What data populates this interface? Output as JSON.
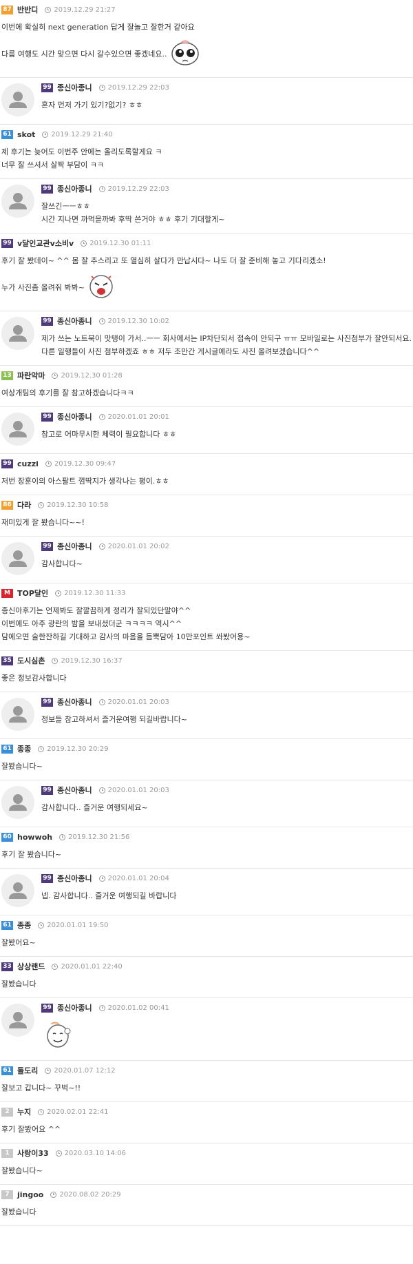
{
  "comments": [
    {
      "level": "87",
      "level_color": "#f0a030",
      "author": "반반디",
      "date": "2019.12.29 21:27",
      "reply": false,
      "lines": [
        "이번에 확실히 next generation 답게 잘놀고 잘한거 같아요",
        "다름 여행도 시간 맞으면 다시 갈수있으면 좋겠네요.."
      ],
      "emoticon": "crying-face-emoticon"
    },
    {
      "level": "99",
      "level_color": "#4e3a7a",
      "author": "종신아종니",
      "date": "2019.12.29 22:03",
      "reply": true,
      "lines": [
        "혼자 먼저 가기 있기?없기? ㅎㅎ"
      ]
    },
    {
      "level": "61",
      "level_color": "#3b8fd6",
      "author": "skot",
      "date": "2019.12.29 21:40",
      "reply": false,
      "lines": [
        "제 후기는 늦어도 이번주 안에는 올리도록할게요 ㅋ",
        "너무 잘 쓰셔서 살짝 부담이 ㅋㅋ"
      ]
    },
    {
      "level": "99",
      "level_color": "#4e3a7a",
      "author": "종신아종니",
      "date": "2019.12.29 22:03",
      "reply": true,
      "lines": [
        "잘쓰긴ㅡㅡㅎㅎ",
        "시간 지나면 까먹을까봐 후딱 쓴거야 ㅎㅎ 후기 기대할게~"
      ]
    },
    {
      "level": "99",
      "level_color": "#4e3a7a",
      "author": "v달인교관v소비v",
      "date": "2019.12.30 01:11",
      "reply": false,
      "lines": [
        "후기 잘 봤데이~ ^^ 몸 잘 추스리고 또 열심히 살다가 만납시다~ 나도 더 잘 준비해 놓고 기다리겠소!",
        "누가 사진좀 올려줘 봐봐~"
      ],
      "emoticon": "shouting-face-emoticon"
    },
    {
      "level": "99",
      "level_color": "#4e3a7a",
      "author": "종신아종니",
      "date": "2019.12.30 10:02",
      "reply": true,
      "lines": [
        "제가 쓰는 노트북이 맛탱이 가서..ㅡㅡ 회사에서는 IP차단되서 접속이 안되구 ㅠㅠ 모바일로는 사진첨부가 잘안되서요.",
        "다른 일행들이 사진 첨부하겠죠 ㅎㅎ 저두 조만간 게시글에라도 사진 올려보겠습니다^^"
      ]
    },
    {
      "level": "13",
      "level_color": "#8cc152",
      "author": "파란악마",
      "date": "2019.12.30 01:28",
      "reply": false,
      "lines": [
        "여상개팀의 후기를 잘 참고하겠습니다ㅋㅋ"
      ]
    },
    {
      "level": "99",
      "level_color": "#4e3a7a",
      "author": "종신아종니",
      "date": "2020.01.01 20:01",
      "reply": true,
      "lines": [
        "참고로 어마무시한 체력이 필요합니다 ㅎㅎ"
      ]
    },
    {
      "level": "99",
      "level_color": "#4e3a7a",
      "author": "cuzzi",
      "date": "2019.12.30 09:47",
      "reply": false,
      "lines": [
        "저번 장훈이의 아스팔트 껌딱지가 생각나는 평이.ㅎㅎ"
      ]
    },
    {
      "level": "86",
      "level_color": "#f0a030",
      "author": "다라",
      "date": "2019.12.30 10:58",
      "reply": false,
      "lines": [
        "재미있게 잘 봤습니다~~!"
      ]
    },
    {
      "level": "99",
      "level_color": "#4e3a7a",
      "author": "종신아종니",
      "date": "2020.01.01 20:02",
      "reply": true,
      "lines": [
        "감사합니다~"
      ]
    },
    {
      "level": "M",
      "level_color": "#d9232e",
      "author": "TOP달인",
      "date": "2019.12.30 11:33",
      "reply": false,
      "lines": [
        "종신아후기는 언제봐도 잘깔끔하게 정리가 잘되있단말야^^",
        "이번에도 아주 광란의 밤을 보내셨더군 ㅋㅋㅋㅋ 역시^^",
        "담에오면 술한잔하길 기대하고 감사의 마음을 듬뿍담아 10만포인트 쏴봤어용~"
      ]
    },
    {
      "level": "35",
      "level_color": "#4e3a7a",
      "author": "도시심촌",
      "date": "2019.12.30 16:37",
      "reply": false,
      "lines": [
        "좋은 정보감사합니다"
      ]
    },
    {
      "level": "99",
      "level_color": "#4e3a7a",
      "author": "종신아종니",
      "date": "2020.01.01 20:03",
      "reply": true,
      "lines": [
        "정보들 참고하셔서 즐거운여행 되길바랍니다~"
      ]
    },
    {
      "level": "61",
      "level_color": "#3b8fd6",
      "author": "종종",
      "date": "2019.12.30 20:29",
      "reply": false,
      "lines": [
        "잘봤습니다~"
      ]
    },
    {
      "level": "99",
      "level_color": "#4e3a7a",
      "author": "종신아종니",
      "date": "2020.01.01 20:03",
      "reply": true,
      "lines": [
        "감사합니다.. 즐거운 여행되세요~"
      ]
    },
    {
      "level": "60",
      "level_color": "#3b8fd6",
      "author": "howwoh",
      "date": "2019.12.30 21:56",
      "reply": false,
      "lines": [
        "후기 잘 봤습니다~"
      ]
    },
    {
      "level": "99",
      "level_color": "#4e3a7a",
      "author": "종신아종니",
      "date": "2020.01.01 20:04",
      "reply": true,
      "lines": [
        "넵.  감사합니다.. 즐거운 여행되길 바랍니다"
      ]
    },
    {
      "level": "61",
      "level_color": "#3b8fd6",
      "author": "종종",
      "date": "2020.01.01 19:50",
      "reply": false,
      "lines": [
        "잘봤어요~"
      ]
    },
    {
      "level": "33",
      "level_color": "#4e3a7a",
      "author": "상상랜드",
      "date": "2020.01.01 22:40",
      "reply": false,
      "lines": [
        "잘봤습니다"
      ]
    },
    {
      "level": "99",
      "level_color": "#4e3a7a",
      "author": "종신아종니",
      "date": "2020.01.02 00:41",
      "reply": true,
      "lines": [],
      "emoticon": "waving-face-emoticon"
    },
    {
      "level": "61",
      "level_color": "#3b8fd6",
      "author": "돌도리",
      "date": "2020.01.07 12:12",
      "reply": false,
      "lines": [
        "잘보고 갑니다~ 꾸벅~!!"
      ]
    },
    {
      "level": "2",
      "level_color": "#c8c8c8",
      "author": "누지",
      "date": "2020.02.01 22:41",
      "reply": false,
      "lines": [
        "후기 잘봤어요 ^^"
      ]
    },
    {
      "level": "1",
      "level_color": "#c8c8c8",
      "author": "사랑이33",
      "date": "2020.03.10 14:06",
      "reply": false,
      "lines": [
        "잘봤습니다~"
      ]
    },
    {
      "level": "7",
      "level_color": "#c8c8c8",
      "author": "jingoo",
      "date": "2020.08.02 20:29",
      "reply": false,
      "lines": [
        "잘봤습니다"
      ]
    }
  ]
}
